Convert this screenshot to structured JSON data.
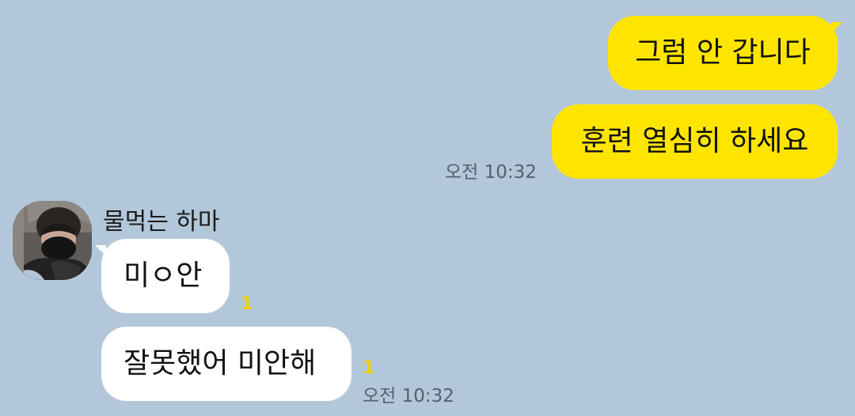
{
  "colors": {
    "background": "#b2c7da",
    "sent_bubble": "#fee500",
    "received_bubble": "#ffffff",
    "timestamp": "#55606b",
    "unread_count": "#f0d000"
  },
  "messages_sent": [
    {
      "text": "그럼 안 갑니다"
    },
    {
      "text": "훈련 열심히 하세요"
    }
  ],
  "sent_time": "오전 10:32",
  "received": {
    "sender_name": "물먹는 하마",
    "avatar_icon": "profile-photo",
    "messages": [
      {
        "text": "미ㅇ안",
        "unread": "1"
      },
      {
        "text": "잘못했어 미안해",
        "unread": "1"
      }
    ],
    "time": "오전 10:32"
  }
}
